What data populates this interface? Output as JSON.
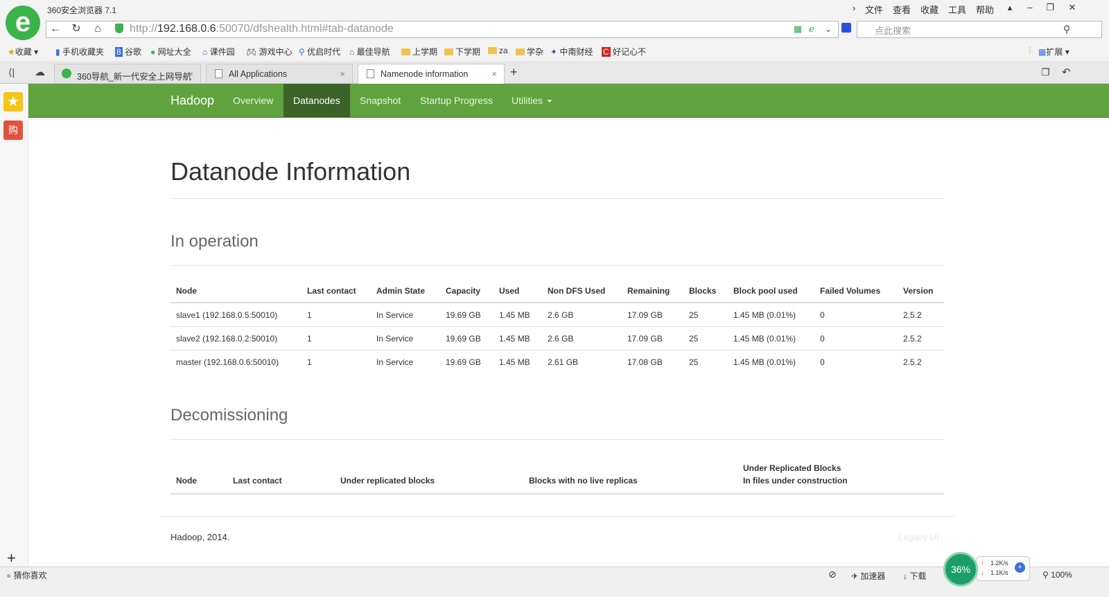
{
  "browser": {
    "app_title": "360安全浏览器 7.1",
    "title_menu": [
      "文件",
      "查看",
      "收藏",
      "工具",
      "帮助"
    ],
    "address": {
      "scheme": "http://",
      "host": "192.168.0.6",
      "rest": ":50070/dfshealth.html#tab-datanode"
    },
    "search_placeholder": "点此搜索",
    "bookmarks": [
      "收藏",
      "手机收藏夹",
      "谷歌",
      "网址大全",
      "课件园",
      "游戏中心",
      "优启时代",
      "最佳导航",
      "上学期",
      "下学期",
      "za",
      "学杂",
      "中南财经",
      "好记心不"
    ],
    "extensions_label": "扩展",
    "tabs": [
      {
        "label": "360导航_新一代安全上网导航",
        "active": false
      },
      {
        "label": "All Applications",
        "active": false
      },
      {
        "label": "Namenode information",
        "active": true
      }
    ],
    "sidebar_shop_label": "购"
  },
  "navbar": {
    "brand": "Hadoop",
    "items": [
      "Overview",
      "Datanodes",
      "Snapshot",
      "Startup Progress",
      "Utilities"
    ],
    "active": "Datanodes",
    "color": "#5fa33e"
  },
  "page": {
    "title": "Datanode Information",
    "in_operation": {
      "heading": "In operation",
      "columns": [
        "Node",
        "Last contact",
        "Admin State",
        "Capacity",
        "Used",
        "Non DFS Used",
        "Remaining",
        "Blocks",
        "Block pool used",
        "Failed Volumes",
        "Version"
      ],
      "rows": [
        [
          "slave1 (192.168.0.5:50010)",
          "1",
          "In Service",
          "19.69 GB",
          "1.45 MB",
          "2.6 GB",
          "17.09 GB",
          "25",
          "1.45 MB (0.01%)",
          "0",
          "2.5.2"
        ],
        [
          "slave2 (192.168.0.2:50010)",
          "1",
          "In Service",
          "19.69 GB",
          "1.45 MB",
          "2.6 GB",
          "17.09 GB",
          "25",
          "1.45 MB (0.01%)",
          "0",
          "2.5.2"
        ],
        [
          "master (192.168.0.6:50010)",
          "1",
          "In Service",
          "19.69 GB",
          "1.45 MB",
          "2.61 GB",
          "17.08 GB",
          "25",
          "1.45 MB (0.01%)",
          "0",
          "2.5.2"
        ]
      ]
    },
    "decomissioning": {
      "heading": "Decomissioning",
      "columns": [
        "Node",
        "Last contact",
        "Under replicated blocks",
        "Blocks with no live replicas"
      ],
      "last_col_line1": "Under Replicated Blocks",
      "last_col_line2": "In files under construction"
    },
    "footer": "Hadoop, 2014.",
    "legacy_link": "Legacy UI"
  },
  "statusbar": {
    "left": "猜你喜欢",
    "accelerator": "加速器",
    "download": "下载",
    "speed_percent": "36%",
    "up_speed": "1.2K/s",
    "down_speed": "1.1K/s",
    "zoom": "100%"
  }
}
